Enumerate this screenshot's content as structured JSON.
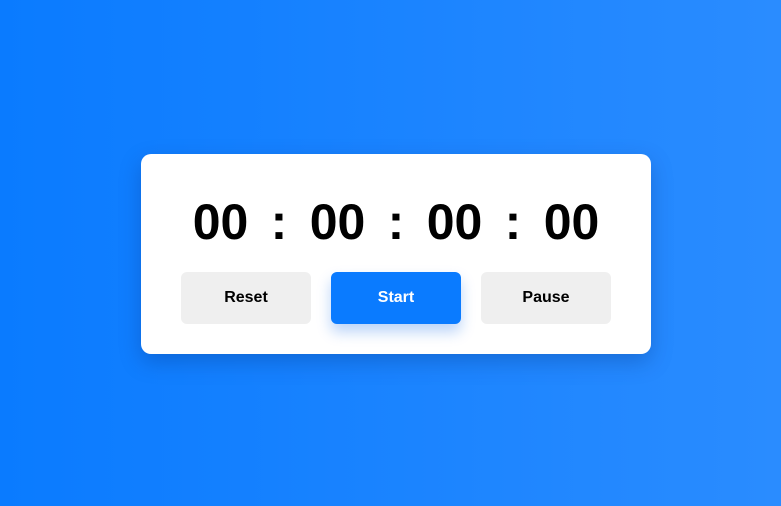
{
  "timer": {
    "hours": "00",
    "minutes": "00",
    "seconds": "00",
    "centiseconds": "00",
    "separator": ":"
  },
  "controls": {
    "reset_label": "Reset",
    "start_label": "Start",
    "pause_label": "Pause"
  },
  "colors": {
    "accent": "#0a7bff",
    "background_start": "#0a7bff",
    "background_end": "#2a8cff",
    "card": "#ffffff",
    "secondary_button": "#efefef"
  }
}
